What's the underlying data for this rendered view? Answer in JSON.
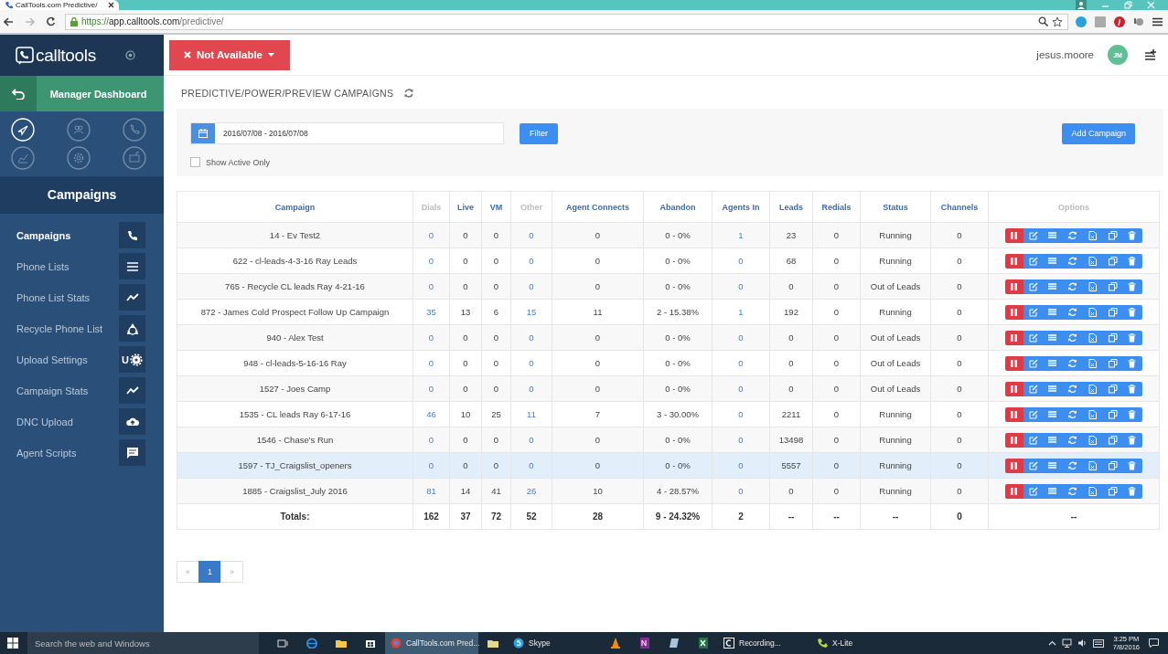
{
  "browser": {
    "tab_title": "CallTools.com Predictive/",
    "url": {
      "scheme": "https://",
      "host": "app.calltools.com",
      "path": "/predictive/"
    }
  },
  "sidebar": {
    "logo": "calltools",
    "dashboard": "Manager Dashboard",
    "modules": [
      {
        "selected": true
      },
      {
        "selected": false
      },
      {
        "selected": false
      },
      {
        "selected": false
      },
      {
        "selected": false
      },
      {
        "selected": false
      }
    ],
    "section_title": "Campaigns",
    "items": [
      {
        "label": "Campaigns",
        "selected": true
      },
      {
        "label": "Phone Lists",
        "selected": false
      },
      {
        "label": "Phone List Stats",
        "selected": false
      },
      {
        "label": "Recycle Phone List",
        "selected": false
      },
      {
        "label": "Upload Settings",
        "selected": false,
        "icon_text": "U"
      },
      {
        "label": "Campaign Stats",
        "selected": false
      },
      {
        "label": "DNC Upload",
        "selected": false
      },
      {
        "label": "Agent Scripts",
        "selected": false
      }
    ]
  },
  "header": {
    "status_button": "Not Available",
    "user": "jesus.moore",
    "avatar": "JM"
  },
  "page_title": "PREDICTIVE/POWER/PREVIEW CAMPAIGNS",
  "filters": {
    "date_range": "2016/07/08 - 2016/07/08",
    "filter_button": "Filter",
    "add_button": "Add Campaign",
    "show_active_only": {
      "label": "Show Active Only",
      "checked": false
    }
  },
  "table": {
    "columns": [
      {
        "label": "Campaign",
        "kind": "text"
      },
      {
        "label": "Dials",
        "kind": "count"
      },
      {
        "label": "Live",
        "kind": "text"
      },
      {
        "label": "VM",
        "kind": "text"
      },
      {
        "label": "Other",
        "kind": "count"
      },
      {
        "label": "Agent Connects",
        "kind": "text"
      },
      {
        "label": "Abandon",
        "kind": "text"
      },
      {
        "label": "Agents In",
        "kind": "agents"
      },
      {
        "label": "Leads",
        "kind": "text"
      },
      {
        "label": "Redials",
        "kind": "text"
      },
      {
        "label": "Status",
        "kind": "text"
      },
      {
        "label": "Channels",
        "kind": "text"
      },
      {
        "label": "Options",
        "kind": "actions"
      }
    ],
    "rows": [
      {
        "cells": [
          "14 - Ev Test2",
          "0",
          "0",
          "0",
          "0",
          "0",
          "0 - 0%",
          "1",
          "23",
          "0",
          "Running",
          "0"
        ],
        "selected": false
      },
      {
        "cells": [
          "622 - cl-leads-4-3-16 Ray Leads",
          "0",
          "0",
          "0",
          "0",
          "0",
          "0 - 0%",
          "0",
          "68",
          "0",
          "Running",
          "0"
        ],
        "selected": false
      },
      {
        "cells": [
          "765 - Recycle CL leads Ray 4-21-16",
          "0",
          "0",
          "0",
          "0",
          "0",
          "0 - 0%",
          "0",
          "0",
          "0",
          "Out of Leads",
          "0"
        ],
        "selected": false
      },
      {
        "cells": [
          "872 - James Cold Prospect Follow Up Campaign",
          "35",
          "13",
          "6",
          "15",
          "11",
          "2 - 15.38%",
          "1",
          "192",
          "0",
          "Running",
          "0"
        ],
        "selected": false
      },
      {
        "cells": [
          "940 - Alex Test",
          "0",
          "0",
          "0",
          "0",
          "0",
          "0 - 0%",
          "0",
          "0",
          "0",
          "Out of Leads",
          "0"
        ],
        "selected": false
      },
      {
        "cells": [
          "948 - cl-leads-5-16-16 Ray",
          "0",
          "0",
          "0",
          "0",
          "0",
          "0 - 0%",
          "0",
          "0",
          "0",
          "Out of Leads",
          "0"
        ],
        "selected": false
      },
      {
        "cells": [
          "1527 - Joes Camp",
          "0",
          "0",
          "0",
          "0",
          "0",
          "0 - 0%",
          "0",
          "0",
          "0",
          "Out of Leads",
          "0"
        ],
        "selected": false
      },
      {
        "cells": [
          "1535 - CL leads Ray 6-17-16",
          "46",
          "10",
          "25",
          "11",
          "7",
          "3 - 30.00%",
          "0",
          "2211",
          "0",
          "Running",
          "0"
        ],
        "selected": false
      },
      {
        "cells": [
          "1546 - Chase's Run",
          "0",
          "0",
          "0",
          "0",
          "0",
          "0 - 0%",
          "0",
          "13498",
          "0",
          "Running",
          "0"
        ],
        "selected": false
      },
      {
        "cells": [
          "1597 - TJ_Craigslist_openers",
          "0",
          "0",
          "0",
          "0",
          "0",
          "0 - 0%",
          "0",
          "5557",
          "0",
          "Running",
          "0"
        ],
        "selected": true
      },
      {
        "cells": [
          "1885 - Craigslist_July 2016",
          "81",
          "14",
          "41",
          "26",
          "10",
          "4 - 28.57%",
          "0",
          "0",
          "0",
          "Running",
          "0"
        ],
        "selected": false
      }
    ],
    "totals": [
      "Totals:",
      "162",
      "37",
      "72",
      "52",
      "28",
      "9 - 24.32%",
      "2",
      "--",
      "--",
      "--",
      "0",
      "--"
    ]
  },
  "pagination": {
    "prev": "«",
    "pages": [
      {
        "label": "1",
        "selected": true
      }
    ],
    "next": "»"
  },
  "taskbar": {
    "search": "Search the web and Windows",
    "apps": [
      {
        "label": "CallTools.com Pred...",
        "selected": true
      },
      {
        "label": "Skype",
        "selected": false
      },
      {
        "label": "Recording...",
        "selected": false
      },
      {
        "label": "X-Lite",
        "selected": false
      }
    ],
    "time": "3:25 PM",
    "date": "7/8/2016"
  }
}
